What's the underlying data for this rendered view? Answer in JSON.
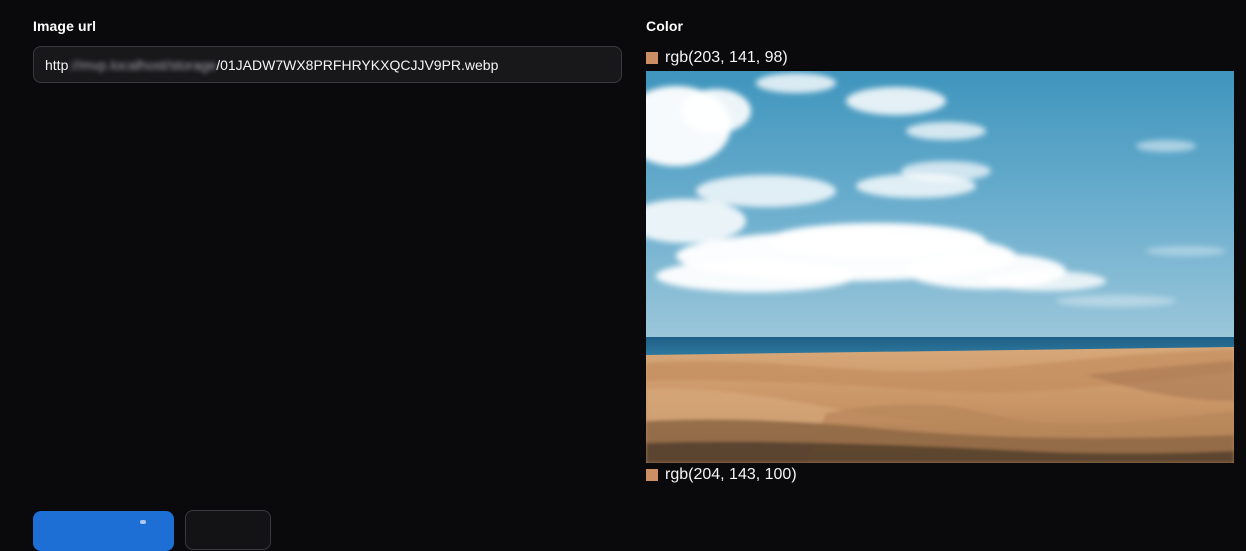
{
  "form": {
    "image_url_label": "Image url",
    "image_url_value": {
      "prefix": "http",
      "blurred": "://mvp.localhost/storage",
      "suffix": "/01JADW7WX8PRFHRYKXQCJJV9PR.webp"
    },
    "color_label": "Color"
  },
  "colors": {
    "top": {
      "text": "rgb(203, 141, 98)",
      "hex": "#cb8d62"
    },
    "bottom": {
      "text": "rgb(204, 143, 100)",
      "hex": "#cc8f64"
    }
  },
  "image_preview": {
    "description_icon": "desert-dunes-photo"
  },
  "buttons": {
    "primary_color": "#1d6fd6",
    "secondary_color": "#131316"
  }
}
